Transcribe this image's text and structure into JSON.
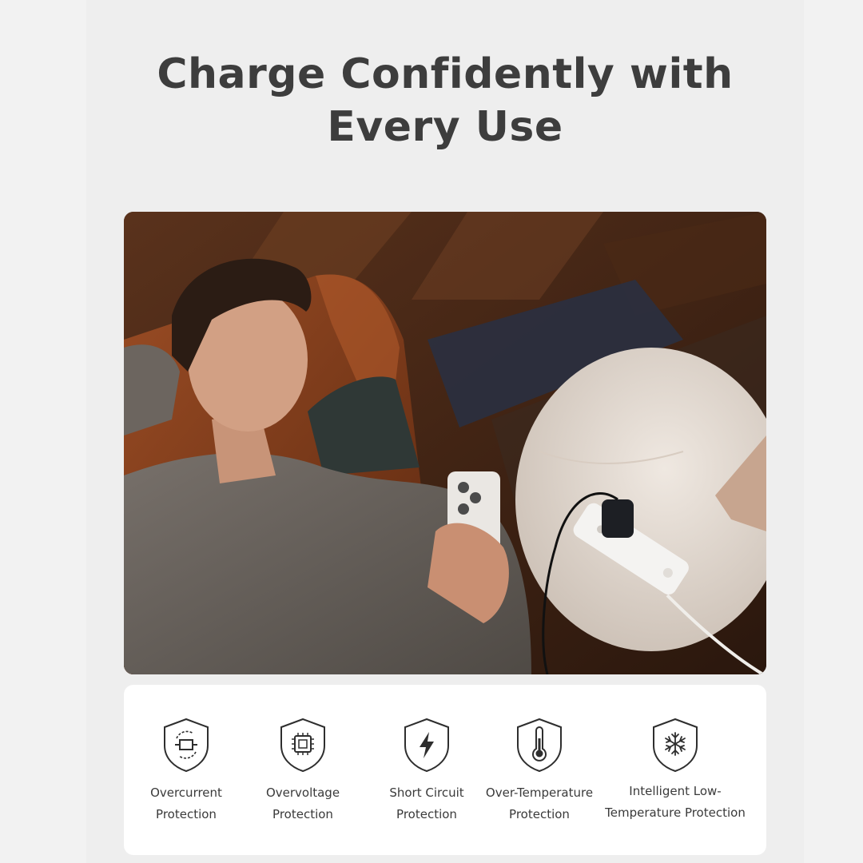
{
  "headline": {
    "line1": "Charge Confidently with",
    "line2": "Every Use"
  },
  "photo": {
    "subject": "man-using-phone-near-charger-on-table"
  },
  "features": [
    {
      "icon": "overcurrent-shield-icon",
      "line1": "Overcurrent",
      "line2": "Protection"
    },
    {
      "icon": "overvoltage-shield-icon",
      "line1": "Overvoltage",
      "line2": "Protection"
    },
    {
      "icon": "short-circuit-shield-icon",
      "line1": "Short Circuit",
      "line2": "Protection"
    },
    {
      "icon": "over-temperature-shield-icon",
      "line1": "Over-Temperature",
      "line2": "Protection"
    },
    {
      "icon": "low-temperature-shield-icon",
      "line1": "Intelligent Low-",
      "line2": "Temperature Protection"
    }
  ],
  "colors": {
    "background": "#eeeeee",
    "headline": "#3d3d3d",
    "card": "#ffffff",
    "icon_stroke": "#2e2e2e"
  }
}
